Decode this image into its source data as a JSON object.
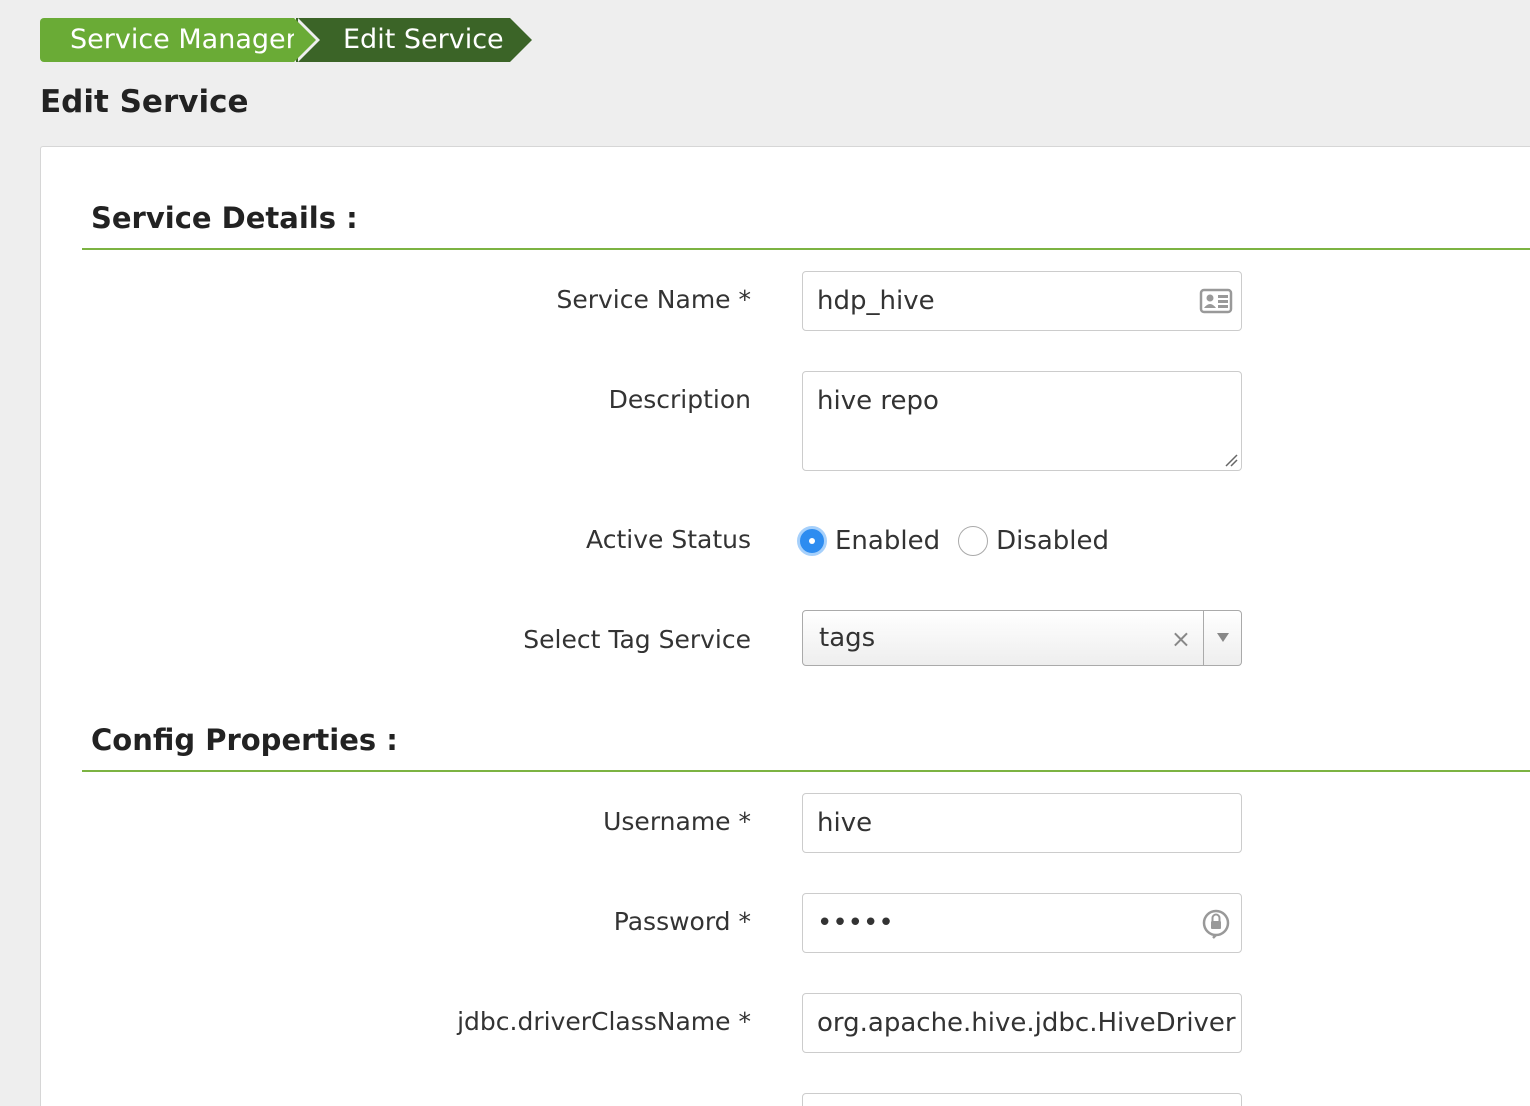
{
  "breadcrumb": {
    "items": [
      "Service Manager",
      "Edit Service"
    ]
  },
  "page": {
    "title": "Edit Service"
  },
  "service_details": {
    "title": "Service Details :",
    "service_name": {
      "label": "Service Name *",
      "value": "hdp_hive",
      "icon": "contact-card-icon"
    },
    "description": {
      "label": "Description",
      "value": "hive repo"
    },
    "active_status": {
      "label": "Active Status",
      "options": [
        "Enabled",
        "Disabled"
      ],
      "selected": "Enabled"
    },
    "tag_service": {
      "label": "Select Tag Service",
      "value": "tags",
      "clear": "×"
    }
  },
  "config_properties": {
    "title": "Config Properties :",
    "username": {
      "label": "Username *",
      "value": "hive"
    },
    "password": {
      "label": "Password *",
      "value": "•••••",
      "icon": "password-manager-icon"
    },
    "jdbc_driver": {
      "label": "jdbc.driverClassName *",
      "value": "org.apache.hive.jdbc.HiveDriver"
    }
  },
  "colors": {
    "breadcrumb_primary": "#6aab36",
    "breadcrumb_active": "#3b6427",
    "section_rule": "#7cb342",
    "radio_selected": "#2d8cf0"
  }
}
